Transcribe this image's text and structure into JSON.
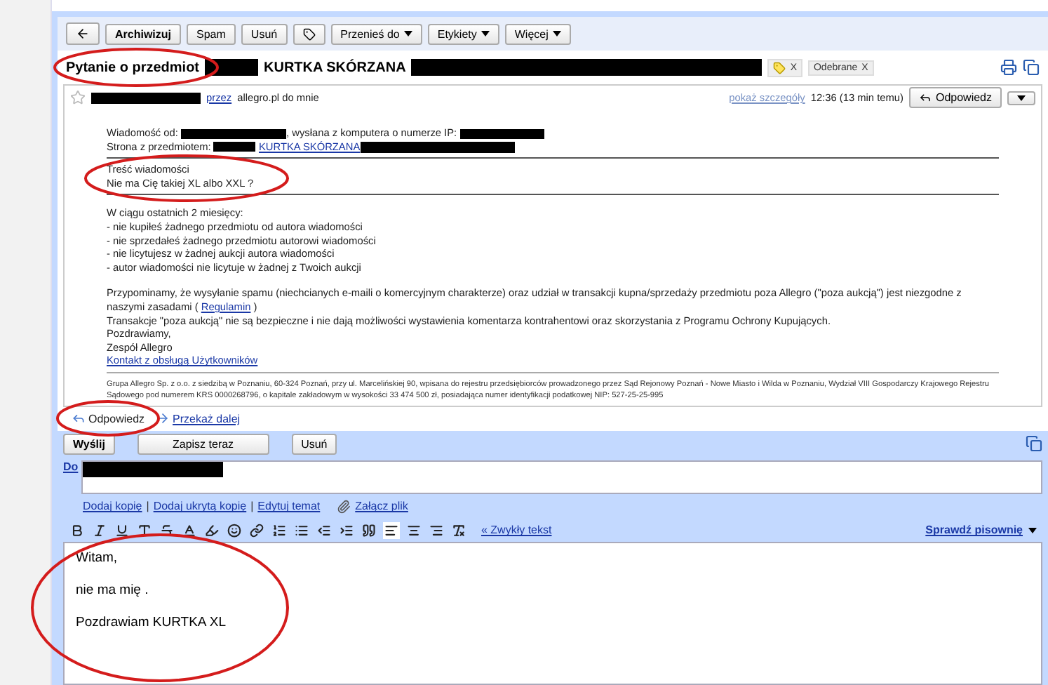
{
  "toolbar": {
    "buttons": [
      "Archiwizuj",
      "Spam",
      "Usuń"
    ],
    "menus": [
      "Przenieś do",
      "Etykiety",
      "Więcej"
    ]
  },
  "subject": {
    "title": "Pytanie o przedmiot",
    "item": "KURTKA SKÓRZANA",
    "labels": [
      {
        "kind": "icon",
        "remove": "X"
      },
      {
        "kind": "text",
        "text": "Odebrane",
        "remove": "X"
      }
    ]
  },
  "message": {
    "starred": false,
    "via": "przez",
    "sender_rest": "allegro.pl do mnie",
    "details_link": "pokaż szczegóły",
    "time": "12:36 (13 min temu)",
    "reply_button": "Odpowiedz",
    "from_label": "Wiadomość od:",
    "ip_label": ", wysłana z komputera o numerze IP:",
    "page_label": "Strona z przedmiotem:",
    "item_link": "KURTKA SKÓRZANA",
    "content_heading": "Treść wiadomości",
    "content_text": "Nie ma Cię takiej XL albo XXL ?",
    "notice_heading": "W ciągu ostatnich 2 miesięcy:",
    "notice_items": [
      "- nie kupiłeś żadnego przedmiotu od autora wiadomości",
      "- nie sprzedałeś żadnego przedmiotu autorowi wiadomości",
      "- nie licytujesz w żadnej aukcji autora wiadomości",
      "- autor wiadomości nie licytuje w żadnej z Twoich aukcji"
    ],
    "reminder_before": "Przypominamy, że wysyłanie spamu (niechcianych e-maili o komercyjnym charakterze) oraz udział w transakcji kupna/sprzedaży przedmiotu poza Allegro (\"poza aukcją\") jest niezgodne z naszymi zasadami (",
    "reminder_link": "Regulamin",
    "reminder_after": ")",
    "closing_lines": [
      "Transakcje \"poza aukcją\" nie są bezpieczne i nie dają możliwości wystawienia komentarza kontrahentowi oraz skorzystania z Programu Ochrony Kupujących.",
      "Pozdrawiamy,",
      "Zespół Allegro"
    ],
    "contact_link": "Kontakt z obsługą Użytkowników",
    "legal": "Grupa Allegro Sp. z o.o. z siedzibą w Poznaniu, 60-324 Poznań, przy ul. Marcelińskiej 90, wpisana do rejestru przedsiębiorców prowadzonego przez Sąd Rejonowy Poznań - Nowe Miasto i Wilda w Poznaniu, Wydział VIII Gospodarczy Krajowego Rejestru Sądowego pod numerem KRS 0000268796, o kapitale zakładowym w wysokości 33 474 500 zł, posiadająca numer identyfikacji podatkowej NIP: 527-25-25-995"
  },
  "reply_bar": {
    "reply": "Odpowiedz",
    "forward": "Przekaż dalej"
  },
  "compose": {
    "buttons": [
      "Wyślij",
      "Zapisz teraz",
      "Usuń"
    ],
    "to_label": "Do",
    "links": [
      "Dodaj kopię",
      "Dodaj ukrytą kopię",
      "Edytuj temat"
    ],
    "separator": "|",
    "attach": "Załącz plik",
    "plain_text": "« Zwykły tekst",
    "spellcheck": "Sprawdź pisownię",
    "body": [
      "Witam,",
      "nie ma mię .",
      "Pozdrawiam KURTKA XL"
    ]
  }
}
